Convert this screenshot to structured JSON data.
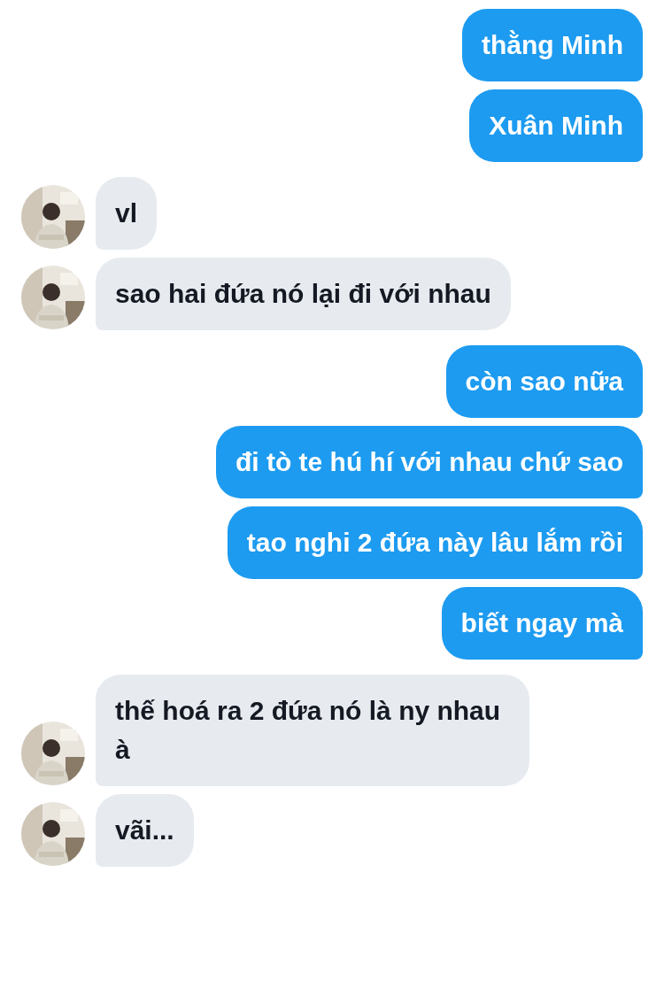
{
  "messages": [
    {
      "kind": "sent",
      "text": "thằng Minh"
    },
    {
      "kind": "sent",
      "text": "Xuân Minh"
    },
    {
      "kind": "received",
      "text": "vl"
    },
    {
      "kind": "received",
      "text": "sao hai đứa nó lại đi với nhau"
    },
    {
      "kind": "sent",
      "text": "còn sao nữa"
    },
    {
      "kind": "sent",
      "text": "đi tò te hú hí với nhau chứ sao"
    },
    {
      "kind": "sent",
      "text": "tao nghi 2 đứa này lâu lắm rồi"
    },
    {
      "kind": "sent",
      "text": "biết ngay mà"
    },
    {
      "kind": "received",
      "text": "thế hoá ra 2 đứa nó là ny nhau à"
    },
    {
      "kind": "received",
      "text": "vãi..."
    }
  ]
}
